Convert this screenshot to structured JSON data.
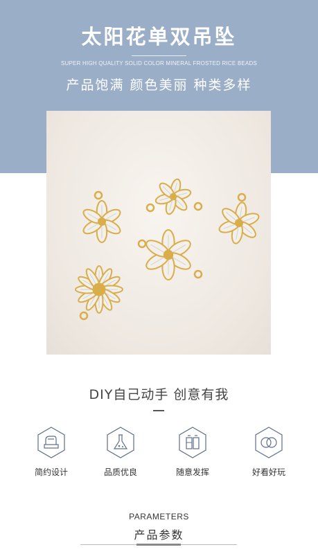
{
  "header": {
    "title": "太阳花单双吊坠",
    "subtitle_en": "SUPER HIGH QUALITY SOLID COLOR MINERAL FROSTED RICE BEADS",
    "subtitle_cn": "产品饱满 颜色美丽 种类多样"
  },
  "photo": {
    "subject": "gold flower pendants with clear crystals",
    "colors": {
      "background": "#ece6df",
      "gold": "#d9ad4a",
      "crystal": "#f3efe9"
    }
  },
  "section": {
    "heading": "DIY自己动手 创意有我"
  },
  "features": [
    {
      "label": "简约设计",
      "icon": "ironing-machine-icon"
    },
    {
      "label": "品质优良",
      "icon": "flask-icon"
    },
    {
      "label": "随意发挥",
      "icon": "paint-tubes-icon"
    },
    {
      "label": "好看好玩",
      "icon": "rings-icon"
    }
  ],
  "parameters": {
    "title_en": "PARAMETERS",
    "title_cn": "产品参数"
  },
  "colors": {
    "banner": "#9aaec8",
    "icon_stroke": "#5b6f8c"
  }
}
